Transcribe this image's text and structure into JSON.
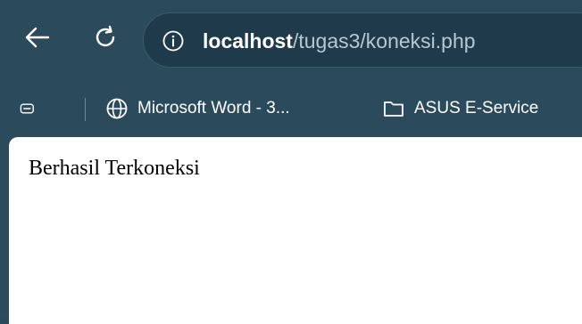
{
  "toolbar": {
    "back_icon": "arrow-left-icon",
    "reload_icon": "reload-icon",
    "info_icon": "info-circle-icon",
    "url_host": "localhost",
    "url_path": "/tugas3/koneksi.php"
  },
  "bookmarks": {
    "items": [
      {
        "label": "Microsoft Word - 3...",
        "icon": "globe-icon"
      },
      {
        "label": "ASUS E-Service",
        "icon": "folder-icon"
      }
    ],
    "tabs_icon": "tab-search-icon"
  },
  "page": {
    "body_text": "Berhasil Terkoneksi"
  },
  "colors": {
    "chrome": "#2b4b5d",
    "omnibox": "#1f3a4a",
    "content": "#ffffff"
  }
}
